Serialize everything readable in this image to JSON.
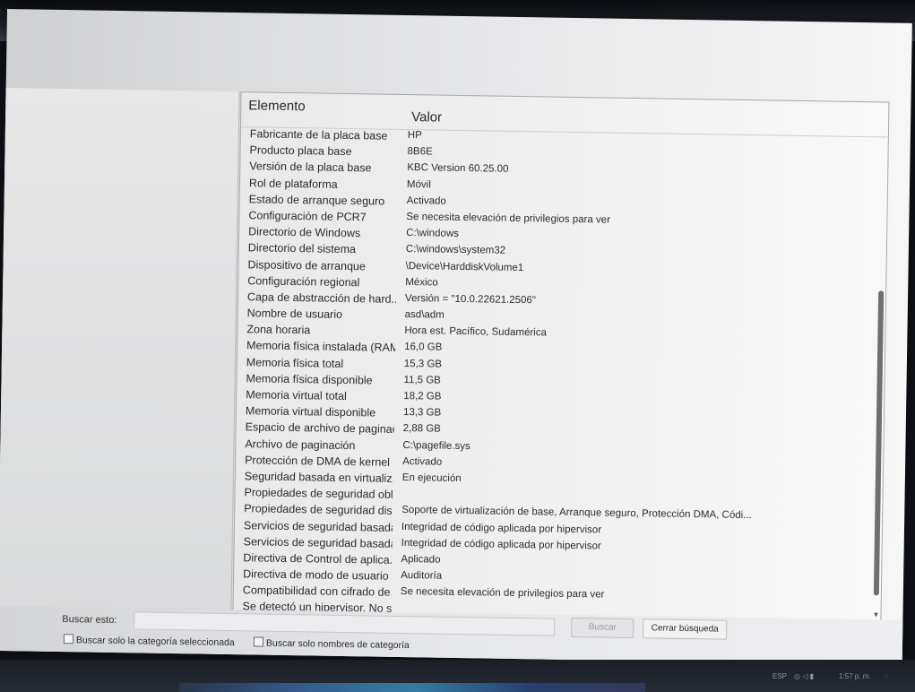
{
  "list": {
    "header": {
      "element": "Elemento",
      "value": "Valor"
    },
    "rows": [
      {
        "element": "Fabricante de la placa base",
        "value": "HP"
      },
      {
        "element": "Producto placa base",
        "value": "8B6E"
      },
      {
        "element": "Versión de la placa base",
        "value": "KBC Version 60.25.00"
      },
      {
        "element": "Rol de plataforma",
        "value": "Móvil"
      },
      {
        "element": "Estado de arranque seguro",
        "value": "Activado"
      },
      {
        "element": "Configuración de PCR7",
        "value": "Se necesita elevación de privilegios para ver"
      },
      {
        "element": "Directorio de Windows",
        "value": "C:\\windows"
      },
      {
        "element": "Directorio del sistema",
        "value": "C:\\windows\\system32"
      },
      {
        "element": "Dispositivo de arranque",
        "value": "\\Device\\HarddiskVolume1"
      },
      {
        "element": "Configuración regional",
        "value": "México"
      },
      {
        "element": "Capa de abstracción de hard...",
        "value": "Versión = \"10.0.22621.2506\""
      },
      {
        "element": "Nombre de usuario",
        "value": "asd\\adm"
      },
      {
        "element": "Zona horaria",
        "value": "Hora est. Pacífico, Sudamérica"
      },
      {
        "element": "Memoria física instalada (RAM)",
        "value": "16,0 GB"
      },
      {
        "element": "Memoria física total",
        "value": "15,3 GB"
      },
      {
        "element": "Memoria física disponible",
        "value": "11,5 GB"
      },
      {
        "element": "Memoria virtual total",
        "value": "18,2 GB"
      },
      {
        "element": "Memoria virtual disponible",
        "value": "13,3 GB"
      },
      {
        "element": "Espacio de archivo de paginac...",
        "value": "2,88 GB"
      },
      {
        "element": "Archivo de paginación",
        "value": "C:\\pagefile.sys"
      },
      {
        "element": "Protección de DMA de kernel",
        "value": "Activado"
      },
      {
        "element": "Seguridad basada en virtualiz...",
        "value": "En ejecución"
      },
      {
        "element": "Propiedades de seguridad obl...",
        "value": ""
      },
      {
        "element": "Propiedades de seguridad dis...",
        "value": "Soporte de virtualización de base, Arranque seguro, Protección DMA, Códi..."
      },
      {
        "element": "Servicios de seguridad basada...",
        "value": "Integridad de código aplicada por hipervisor"
      },
      {
        "element": "Servicios de seguridad basada...",
        "value": "Integridad de código aplicada por hipervisor"
      },
      {
        "element": "Directiva de Control de aplica...",
        "value": "Aplicado"
      },
      {
        "element": "Directiva de modo de usuario ...",
        "value": "Auditoría"
      },
      {
        "element": "Compatibilidad con cifrado de...",
        "value": "Se necesita elevación de privilegios para ver"
      },
      {
        "element": "Se detectó un hipervisor. No s...",
        "value": ""
      }
    ]
  },
  "search": {
    "label": "Buscar esto:",
    "input_value": "",
    "find_button": "Buscar",
    "close_button": "Cerrar búsqueda",
    "checkbox_selected_category": "Buscar solo la categoría seleccionada",
    "checkbox_category_names": "Buscar solo nombres de categoría"
  },
  "tray": {
    "language": "ESP",
    "time": "1:57 p. m."
  }
}
